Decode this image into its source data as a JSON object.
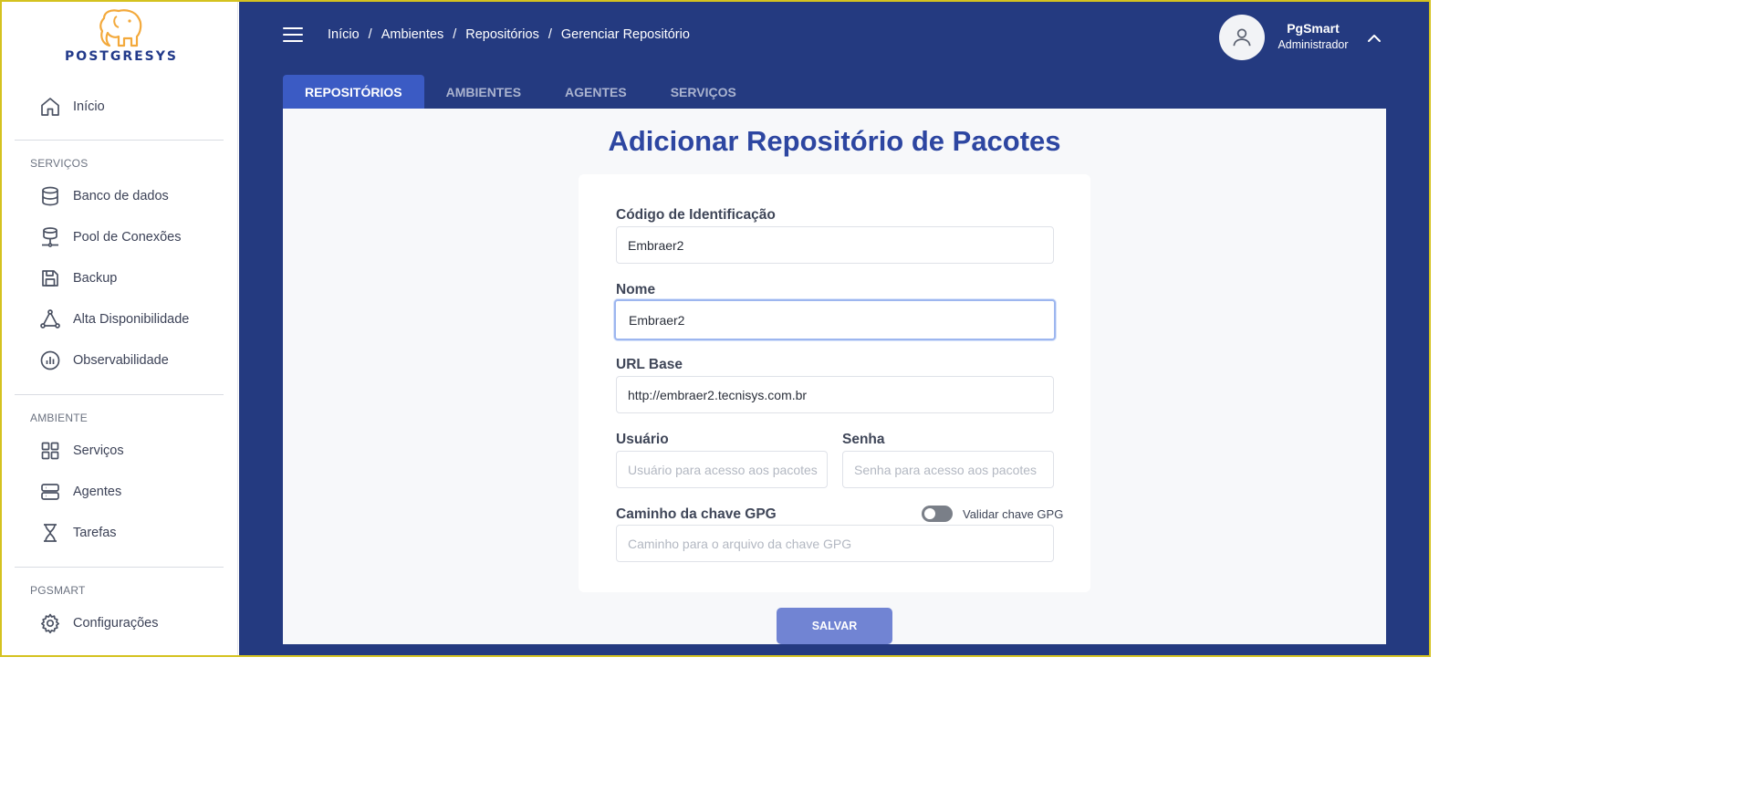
{
  "brand": {
    "name": "POSTGRESYS",
    "logo_color": "#f3a93b",
    "text_color": "#223a8a"
  },
  "sidebar": {
    "home": {
      "label": "Início",
      "icon": "home-icon"
    },
    "sections": [
      {
        "title": "SERVIÇOS",
        "items": [
          {
            "label": "Banco de dados",
            "icon": "database-icon"
          },
          {
            "label": "Pool de Conexões",
            "icon": "connection-pool-icon"
          },
          {
            "label": "Backup",
            "icon": "save-icon"
          },
          {
            "label": "Alta Disponibilidade",
            "icon": "triangle-nodes-icon"
          },
          {
            "label": "Observabilidade",
            "icon": "bar-chart-circle-icon"
          }
        ]
      },
      {
        "title": "AMBIENTE",
        "items": [
          {
            "label": "Serviços",
            "icon": "grid-icon"
          },
          {
            "label": "Agentes",
            "icon": "server-icon"
          },
          {
            "label": "Tarefas",
            "icon": "hourglass-icon"
          }
        ]
      },
      {
        "title": "PGSMART",
        "items": [
          {
            "label": "Configurações",
            "icon": "gear-icon"
          }
        ]
      }
    ]
  },
  "header": {
    "breadcrumb": [
      "Início",
      "Ambientes",
      "Repositórios",
      "Gerenciar Repositório"
    ],
    "separator": "/",
    "user": {
      "name": "PgSmart",
      "role": "Administrador"
    }
  },
  "tabs": [
    {
      "label": "REPOSITÓRIOS",
      "active": true
    },
    {
      "label": "AMBIENTES",
      "active": false
    },
    {
      "label": "AGENTES",
      "active": false
    },
    {
      "label": "SERVIÇOS",
      "active": false
    }
  ],
  "form": {
    "title": "Adicionar Repositório de Pacotes",
    "codigo": {
      "label": "Código de Identificação",
      "value": "Embraer2"
    },
    "nome": {
      "label": "Nome",
      "value": "Embraer2"
    },
    "url_base": {
      "label": "URL Base",
      "value": "http://embraer2.tecnisys.com.br"
    },
    "usuario": {
      "label": "Usuário",
      "placeholder": "Usuário para acesso aos pacotes"
    },
    "senha": {
      "label": "Senha",
      "placeholder": "Senha para acesso aos pacotes"
    },
    "gpg": {
      "label": "Caminho da chave GPG",
      "placeholder": "Caminho para o arquivo da chave GPG",
      "toggle_label": "Validar chave GPG",
      "toggle_on": false
    },
    "save_label": "SALVAR"
  },
  "colors": {
    "primary": "#243a80",
    "accent": "#3b5bc4",
    "title": "#2d46a1",
    "button": "#7184d3"
  }
}
